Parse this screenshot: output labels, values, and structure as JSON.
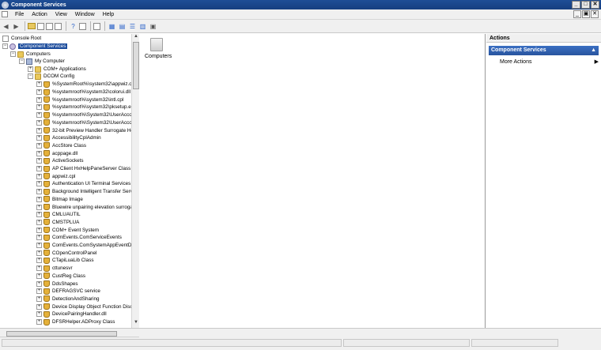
{
  "window": {
    "title": "Component Services",
    "minimize": "_",
    "maximize": "□",
    "close": "✕"
  },
  "menu": {
    "items": [
      "File",
      "Action",
      "View",
      "Window",
      "Help"
    ],
    "mdi": [
      "_",
      "▣",
      "✕"
    ]
  },
  "toolbar": {
    "icons": [
      "back-arrow-icon",
      "forward-arrow-icon",
      "up-folder-icon",
      "show-hide-tree-icon",
      "refresh-icon",
      "export-list-icon",
      "help-icon",
      "properties-icon",
      "view-icon",
      "large-icons-view-icon",
      "small-icons-view-icon",
      "list-view-icon",
      "detail-view-icon",
      "status-view-icon"
    ]
  },
  "tree": {
    "root": "Console Root",
    "component_services": "Component Services",
    "computers": "Computers",
    "my_computer": "My Computer",
    "com_apps": "COM+ Applications",
    "dcom_config": "DCOM Config",
    "dcom_items": [
      "%SystemRoot%\\system32\\appwiz.cp",
      "%systemroot%\\system32\\colorui.dll",
      "%systemroot%\\system32\\intl.cpl",
      "%systemroot%\\system32\\pksetup.e",
      "%systemroot%\\System32\\UserAcco",
      "%systemroot%\\System32\\UserAcco",
      "32-bit Preview Handler Surrogate Ho",
      "AccessibilityCplAdmin",
      "AccStore Class",
      "acppage.dll",
      "ActiveSockets",
      "AP Client HxHelpPaneServer Class",
      "appwiz.cpl",
      "Authentication UI Terminal Services E",
      "Background Intelligent Transfer Servi",
      "Bitmap Image",
      "Bluewire unpairing elevation surrogat",
      "CMLUAUTIL",
      "CMSTPLUA",
      "COM+ Event System",
      "ComEvents.ComServiceEvents",
      "ComEvents.ComSystemAppEventDat",
      "COpenControlPanel",
      "CTapiLuaLib Class",
      "cttunesvr",
      "CustReg Class",
      "DdsShapes",
      "DEFRAGSVC service",
      "DetectionAndSharing",
      "Device Display Object Function Disco",
      "DevicePairingHandler.dll",
      "DFSRHelper.ADProxy Class"
    ]
  },
  "main": {
    "item_label": "Computers"
  },
  "actions": {
    "header": "Actions",
    "section": "Component Services",
    "section_caret": "▲",
    "more": "More Actions",
    "more_arrow": "▶"
  }
}
